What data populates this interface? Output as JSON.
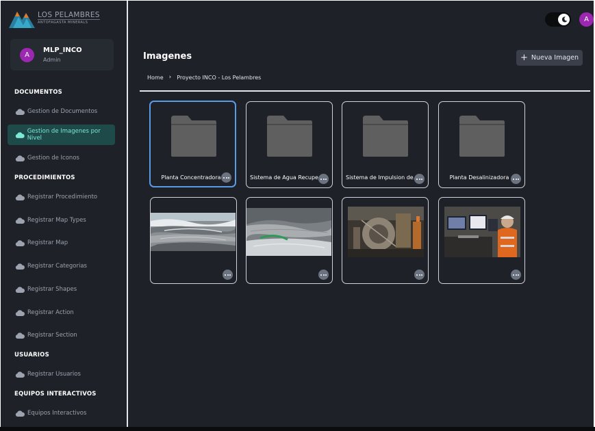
{
  "brand": {
    "title": "LOS PELAMBRES",
    "subtitle": "ANTOFAGASTA MINERALS"
  },
  "user": {
    "initial": "A",
    "name": "MLP_INCO",
    "role": "Admin"
  },
  "sidebar": {
    "sections": [
      {
        "title": "DOCUMENTOS",
        "items": [
          "Gestion de Documentos",
          "Gestion de Imagenes por Nivel",
          "Gestion de Iconos"
        ]
      },
      {
        "title": "PROCEDIMIENTOS",
        "items": [
          "Registrar Procedimiento",
          "Registrar Map Types",
          "Registrar Map",
          "Registrar Categorias",
          "Registrar Shapes",
          "Registrar Action",
          "Registrar Section"
        ]
      },
      {
        "title": "USUARIOS",
        "items": [
          "Registrar Usuarios"
        ]
      },
      {
        "title": "EQUIPOS INTERACTIVOS",
        "items": [
          "Equipos Interactivos"
        ]
      }
    ],
    "active_item": "Gestion de Imagenes por Nivel"
  },
  "header": {
    "avatar_initial": "A",
    "theme_toggle_icon": "moon-icon"
  },
  "main": {
    "title": "Imagenes",
    "new_button": "Nueva Imagen",
    "breadcrumb": [
      "Home",
      "Proyecto INCO - Los Pelambres"
    ],
    "folders": [
      {
        "label": "Planta Concentradora",
        "selected": true
      },
      {
        "label": "Sistema de Agua Recuperada",
        "selected": false
      },
      {
        "label": "Sistema de Impulsion de Agua",
        "selected": false
      },
      {
        "label": "Planta Desalinizadora",
        "selected": false
      }
    ],
    "images": [
      {
        "name": "open-pit-mine-photo"
      },
      {
        "name": "mine-pit-aerial-photo"
      },
      {
        "name": "industrial-machinery-photo"
      },
      {
        "name": "control-room-operator-photo"
      }
    ]
  },
  "colors": {
    "background": "#1e2128",
    "accent_active": "#7ce8d6",
    "avatar": "#9c27b0",
    "selected_border": "#5a9be8"
  }
}
